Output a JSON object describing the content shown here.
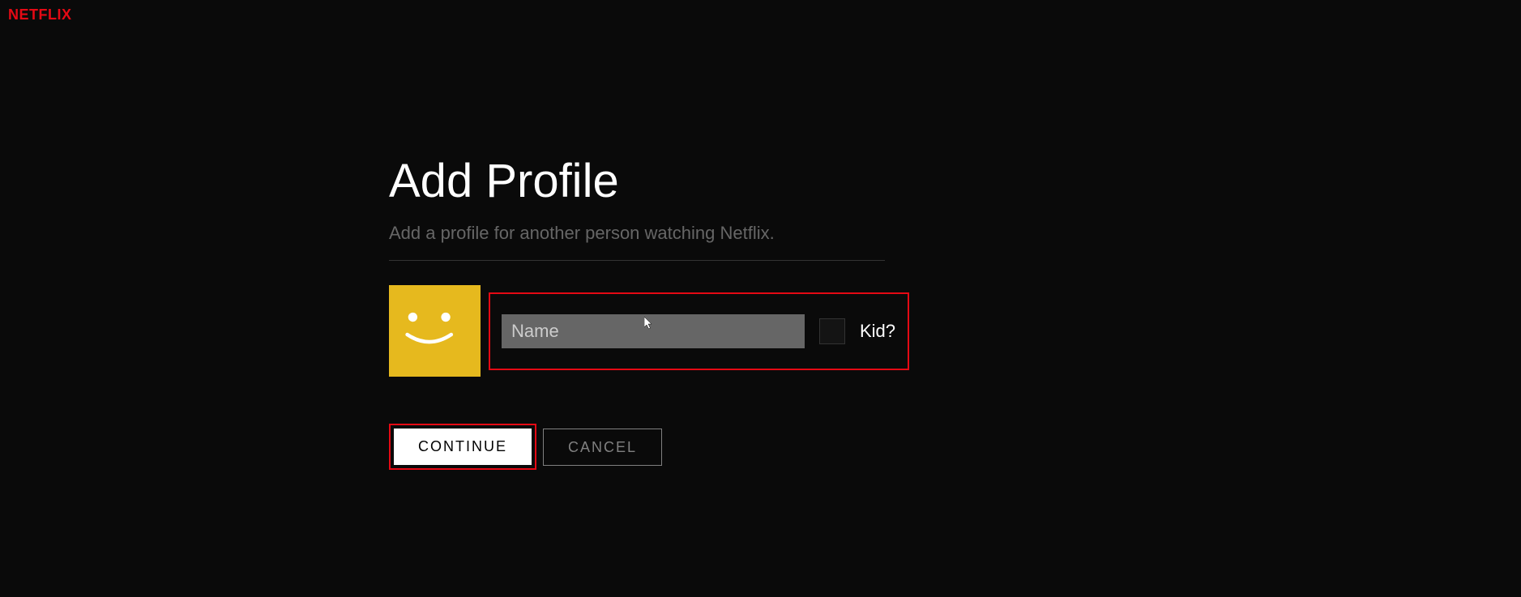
{
  "brand": "NETFLIX",
  "page": {
    "title": "Add Profile",
    "subtitle": "Add a profile for another person watching Netflix."
  },
  "form": {
    "name_value": "",
    "name_placeholder": "Name",
    "kid_label": "Kid?",
    "kid_checked": false
  },
  "buttons": {
    "continue": "CONTINUE",
    "cancel": "CANCEL"
  },
  "avatar": {
    "icon": "smiley-face-icon",
    "bg_color": "#e6b91e"
  },
  "highlights": {
    "input_group_border": "#e50914",
    "continue_border": "#e50914"
  }
}
